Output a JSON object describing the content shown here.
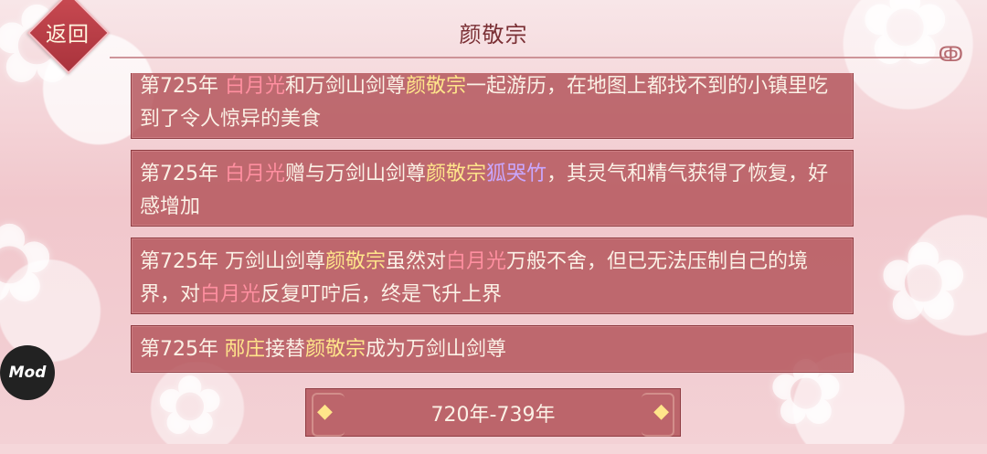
{
  "header": {
    "title": "颜敬宗",
    "back_label": "返回"
  },
  "entries": [
    {
      "parts": [
        {
          "t": "第725年 ",
          "c": ""
        },
        {
          "t": "白月光",
          "c": "pink"
        },
        {
          "t": "和万剑山剑尊",
          "c": ""
        },
        {
          "t": "颜敬宗",
          "c": "yellow"
        },
        {
          "t": "一起游历，在地图上都找不到的小镇里吃到了令人惊异的美食",
          "c": ""
        }
      ]
    },
    {
      "parts": [
        {
          "t": "第725年 ",
          "c": ""
        },
        {
          "t": "白月光",
          "c": "pink"
        },
        {
          "t": "赠与万剑山剑尊",
          "c": ""
        },
        {
          "t": "颜敬宗",
          "c": "yellow"
        },
        {
          "t": "狐哭竹",
          "c": "purple"
        },
        {
          "t": "，其灵气和精气获得了恢复，好感增加",
          "c": ""
        }
      ]
    },
    {
      "parts": [
        {
          "t": "第725年 万剑山剑尊",
          "c": ""
        },
        {
          "t": "颜敬宗",
          "c": "yellow"
        },
        {
          "t": "虽然对",
          "c": ""
        },
        {
          "t": "白月光",
          "c": "pink"
        },
        {
          "t": "万般不舍，但已无法压制自己的境界，对",
          "c": ""
        },
        {
          "t": "白月光",
          "c": "pink"
        },
        {
          "t": "反复叮咛后，终是飞升上界",
          "c": ""
        }
      ]
    },
    {
      "parts": [
        {
          "t": "第725年 ",
          "c": ""
        },
        {
          "t": "邴庄",
          "c": "yellow"
        },
        {
          "t": "接替",
          "c": ""
        },
        {
          "t": "颜敬宗",
          "c": "yellow"
        },
        {
          "t": "成为万剑山剑尊",
          "c": ""
        }
      ]
    }
  ],
  "pager": {
    "range_label": "720年-739年",
    "prev_icon": "left-diamond-icon",
    "next_icon": "right-diamond-icon"
  },
  "mod_badge": {
    "label": "Mod"
  },
  "colors": {
    "pink": "#ff8fa0",
    "yellow": "#ffe58a",
    "purple": "#c9a7ff",
    "panel": "#b25258"
  }
}
